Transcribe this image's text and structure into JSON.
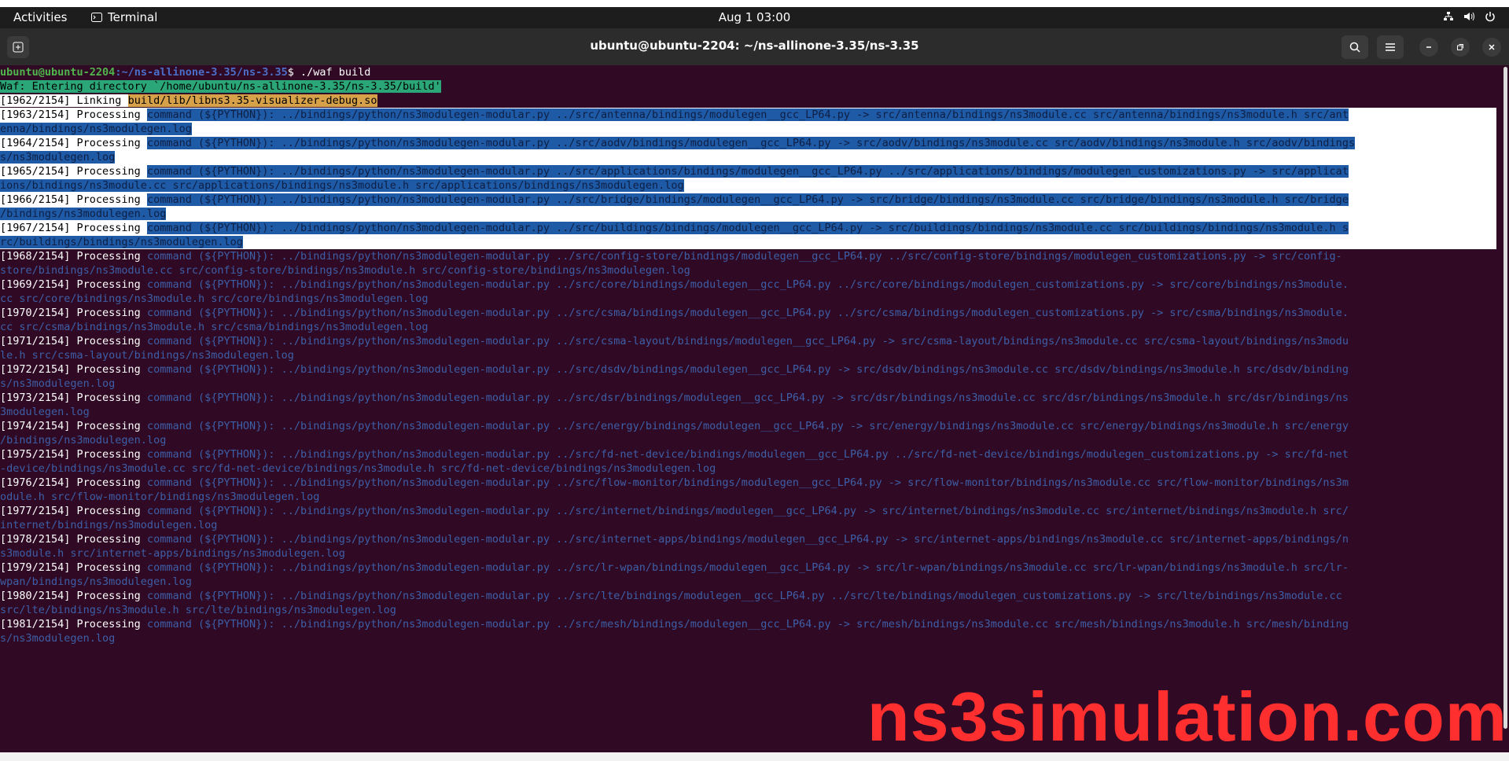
{
  "topbar": {
    "activities": "Activities",
    "app_name": "Terminal",
    "clock": "Aug 1  03:00",
    "tray_icons": [
      "network-icon",
      "volume-icon",
      "power-icon"
    ]
  },
  "header": {
    "title": "ubuntu@ubuntu-2204: ~/ns-allinone-3.35/ns-3.35"
  },
  "terminal": {
    "prompt_user": "ubuntu@ubuntu-2204",
    "prompt_path": ":~/ns-allinone-3.35/ns-3.35",
    "prompt_symbol": "$ ",
    "command": "./waf build",
    "waf_line": "Waf: Entering directory `/home/ubuntu/ns-allinone-3.35/ns-3.35/build'",
    "link_prefix": "[1962/2154] Linking ",
    "link_target": "build/lib/libns3.35-visualizer-debug.so",
    "lines": [
      {
        "a": "[1963/2154] Processing ",
        "b": "command (${PYTHON}): ../bindings/python/ns3modulegen-modular.py ../src/antenna/bindings/modulegen__gcc_LP64.py -> src/antenna/bindings/ns3module.cc src/antenna/bindings/ns3module.h src/ant",
        "c": "enna/bindings/ns3modulegen.log"
      },
      {
        "a": "[1964/2154] Processing ",
        "b": "command (${PYTHON}): ../bindings/python/ns3modulegen-modular.py ../src/aodv/bindings/modulegen__gcc_LP64.py -> src/aodv/bindings/ns3module.cc src/aodv/bindings/ns3module.h src/aodv/bindings",
        "c": "s/ns3modulegen.log"
      },
      {
        "a": "[1965/2154] Processing ",
        "b": "command (${PYTHON}): ../bindings/python/ns3modulegen-modular.py ../src/applications/bindings/modulegen__gcc_LP64.py ../src/applications/bindings/modulegen_customizations.py -> src/applicat",
        "c": "ions/bindings/ns3module.cc src/applications/bindings/ns3module.h src/applications/bindings/ns3modulegen.log"
      },
      {
        "a": "[1966/2154] Processing ",
        "b": "command (${PYTHON}): ../bindings/python/ns3modulegen-modular.py ../src/bridge/bindings/modulegen__gcc_LP64.py -> src/bridge/bindings/ns3module.cc src/bridge/bindings/ns3module.h src/bridge",
        "c": "/bindings/ns3modulegen.log"
      },
      {
        "a": "[1967/2154] Processing ",
        "b": "command (${PYTHON}): ../bindings/python/ns3modulegen-modular.py ../src/buildings/bindings/modulegen__gcc_LP64.py -> src/buildings/bindings/ns3module.cc src/buildings/bindings/ns3module.h s",
        "c": "rc/buildings/bindings/ns3modulegen.log"
      },
      {
        "a": "[1968/2154] Processing ",
        "b": "command (${PYTHON}): ../bindings/python/ns3modulegen-modular.py ../src/config-store/bindings/modulegen__gcc_LP64.py ../src/config-store/bindings/modulegen_customizations.py -> src/config-",
        "c": "store/bindings/ns3module.cc src/config-store/bindings/ns3module.h src/config-store/bindings/ns3modulegen.log"
      },
      {
        "a": "[1969/2154] Processing ",
        "b": "command (${PYTHON}): ../bindings/python/ns3modulegen-modular.py ../src/core/bindings/modulegen__gcc_LP64.py ../src/core/bindings/modulegen_customizations.py -> src/core/bindings/ns3module.",
        "c": "cc src/core/bindings/ns3module.h src/core/bindings/ns3modulegen.log"
      },
      {
        "a": "[1970/2154] Processing ",
        "b": "command (${PYTHON}): ../bindings/python/ns3modulegen-modular.py ../src/csma/bindings/modulegen__gcc_LP64.py ../src/csma/bindings/modulegen_customizations.py -> src/csma/bindings/ns3module.",
        "c": "cc src/csma/bindings/ns3module.h src/csma/bindings/ns3modulegen.log"
      },
      {
        "a": "[1971/2154] Processing ",
        "b": "command (${PYTHON}): ../bindings/python/ns3modulegen-modular.py ../src/csma-layout/bindings/modulegen__gcc_LP64.py -> src/csma-layout/bindings/ns3module.cc src/csma-layout/bindings/ns3modu",
        "c": "le.h src/csma-layout/bindings/ns3modulegen.log"
      },
      {
        "a": "[1972/2154] Processing ",
        "b": "command (${PYTHON}): ../bindings/python/ns3modulegen-modular.py ../src/dsdv/bindings/modulegen__gcc_LP64.py -> src/dsdv/bindings/ns3module.cc src/dsdv/bindings/ns3module.h src/dsdv/binding",
        "c": "s/ns3modulegen.log"
      },
      {
        "a": "[1973/2154] Processing ",
        "b": "command (${PYTHON}): ../bindings/python/ns3modulegen-modular.py ../src/dsr/bindings/modulegen__gcc_LP64.py -> src/dsr/bindings/ns3module.cc src/dsr/bindings/ns3module.h src/dsr/bindings/ns",
        "c": "3modulegen.log"
      },
      {
        "a": "[1974/2154] Processing ",
        "b": "command (${PYTHON}): ../bindings/python/ns3modulegen-modular.py ../src/energy/bindings/modulegen__gcc_LP64.py -> src/energy/bindings/ns3module.cc src/energy/bindings/ns3module.h src/energy",
        "c": "/bindings/ns3modulegen.log"
      },
      {
        "a": "[1975/2154] Processing ",
        "b": "command (${PYTHON}): ../bindings/python/ns3modulegen-modular.py ../src/fd-net-device/bindings/modulegen__gcc_LP64.py ../src/fd-net-device/bindings/modulegen_customizations.py -> src/fd-net",
        "c": "-device/bindings/ns3module.cc src/fd-net-device/bindings/ns3module.h src/fd-net-device/bindings/ns3modulegen.log"
      },
      {
        "a": "[1976/2154] Processing ",
        "b": "command (${PYTHON}): ../bindings/python/ns3modulegen-modular.py ../src/flow-monitor/bindings/modulegen__gcc_LP64.py -> src/flow-monitor/bindings/ns3module.cc src/flow-monitor/bindings/ns3m",
        "c": "odule.h src/flow-monitor/bindings/ns3modulegen.log"
      },
      {
        "a": "[1977/2154] Processing ",
        "b": "command (${PYTHON}): ../bindings/python/ns3modulegen-modular.py ../src/internet/bindings/modulegen__gcc_LP64.py -> src/internet/bindings/ns3module.cc src/internet/bindings/ns3module.h src/",
        "c": "internet/bindings/ns3modulegen.log"
      },
      {
        "a": "[1978/2154] Processing ",
        "b": "command (${PYTHON}): ../bindings/python/ns3modulegen-modular.py ../src/internet-apps/bindings/modulegen__gcc_LP64.py -> src/internet-apps/bindings/ns3module.cc src/internet-apps/bindings/n",
        "c": "s3module.h src/internet-apps/bindings/ns3modulegen.log"
      },
      {
        "a": "[1979/2154] Processing ",
        "b": "command (${PYTHON}): ../bindings/python/ns3modulegen-modular.py ../src/lr-wpan/bindings/modulegen__gcc_LP64.py -> src/lr-wpan/bindings/ns3module.cc src/lr-wpan/bindings/ns3module.h src/lr-",
        "c": "wpan/bindings/ns3modulegen.log"
      },
      {
        "a": "[1980/2154] Processing ",
        "b": "command (${PYTHON}): ../bindings/python/ns3modulegen-modular.py ../src/lte/bindings/modulegen__gcc_LP64.py ../src/lte/bindings/modulegen_customizations.py -> src/lte/bindings/ns3module.cc",
        "c": "src/lte/bindings/ns3module.h src/lte/bindings/ns3modulegen.log"
      },
      {
        "a": "[1981/2154] Processing ",
        "b": "command (${PYTHON}): ../bindings/python/ns3modulegen-modular.py ../src/mesh/bindings/modulegen__gcc_LP64.py -> src/mesh/bindings/ns3module.cc src/mesh/bindings/ns3module.h src/mesh/binding",
        "c": "s/ns3modulegen.log"
      }
    ]
  },
  "watermark": "ns3simulation.com",
  "colors": {
    "terminal_bg": "#300a24",
    "selection_blue": "#1f5aa6",
    "command_text": "#3d5fa8",
    "watermark": "#ff2f2f",
    "prompt_user": "#4fb54c",
    "prompt_path": "#4b6fc9"
  }
}
